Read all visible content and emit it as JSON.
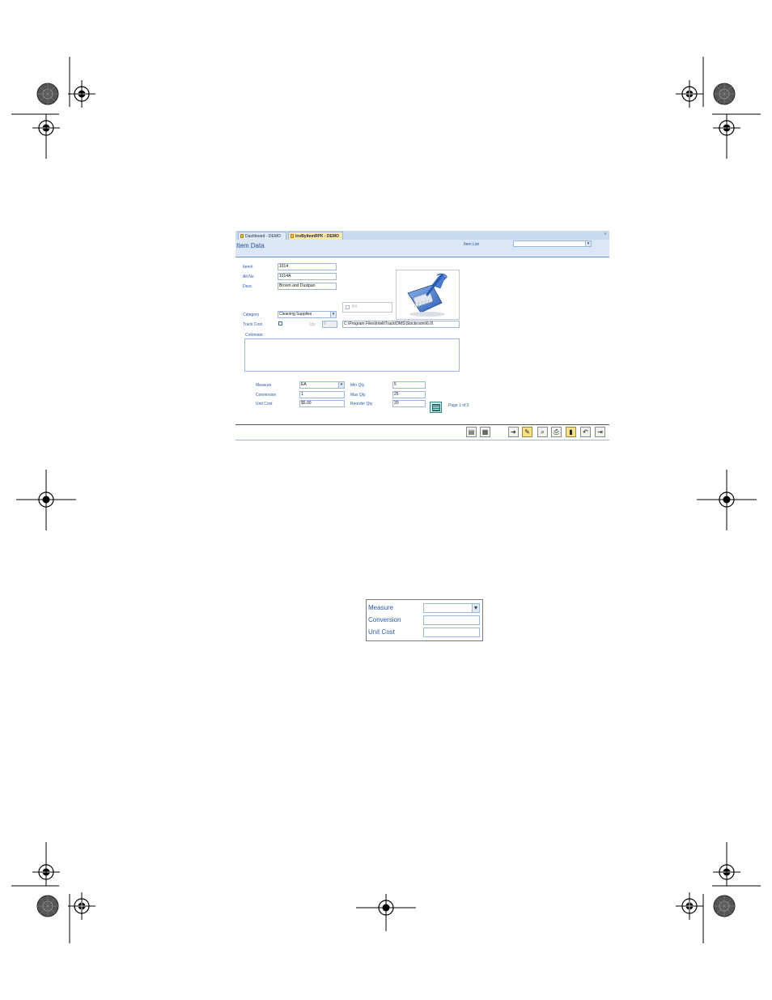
{
  "tabs": [
    {
      "label": "Dashboard - DEMO"
    },
    {
      "label": "InvByItemRPK - DEMO"
    }
  ],
  "header": {
    "title": "Item Data",
    "item_list_label": "Item List"
  },
  "form": {
    "item_label": "Item#",
    "item_value": "1014",
    "alt_label": "Alt No",
    "alt_value": "1014A",
    "desc_label": "Desc",
    "desc_value": "Broom and Dustpan",
    "kit_label": "Kit",
    "category_label": "Category",
    "category_value": "Cleaning Supplies",
    "track_cost_label": "Track Cost",
    "qty_label": "Qty",
    "qty_value": "0",
    "image_path": "C:\\Program Files\\IntelliTrack\\DMS\\Stockroom\\6.0\\",
    "comment_label": "Comment",
    "measure_label": "Measure",
    "measure_value": "EA",
    "conversion_label": "Conversion",
    "conversion_value": "1",
    "unit_cost_label": "Unit Cost",
    "unit_cost_value": "$5.00",
    "min_qty_label": "Min Qty",
    "min_qty_value": "5",
    "max_qty_label": "Max Qty",
    "max_qty_value": "25",
    "reorder_qty_label": "Reorder Qty",
    "reorder_qty_value": "20",
    "page_label": "Page 1 of 2"
  },
  "zoom": {
    "measure_label": "Measure",
    "conversion_label": "Conversion",
    "unit_cost_label": "Unit Cost"
  },
  "colors": {
    "label_blue": "#2a5aa8",
    "header_bg": "#dbe7f6",
    "active_tab": "#ffe7a8"
  }
}
